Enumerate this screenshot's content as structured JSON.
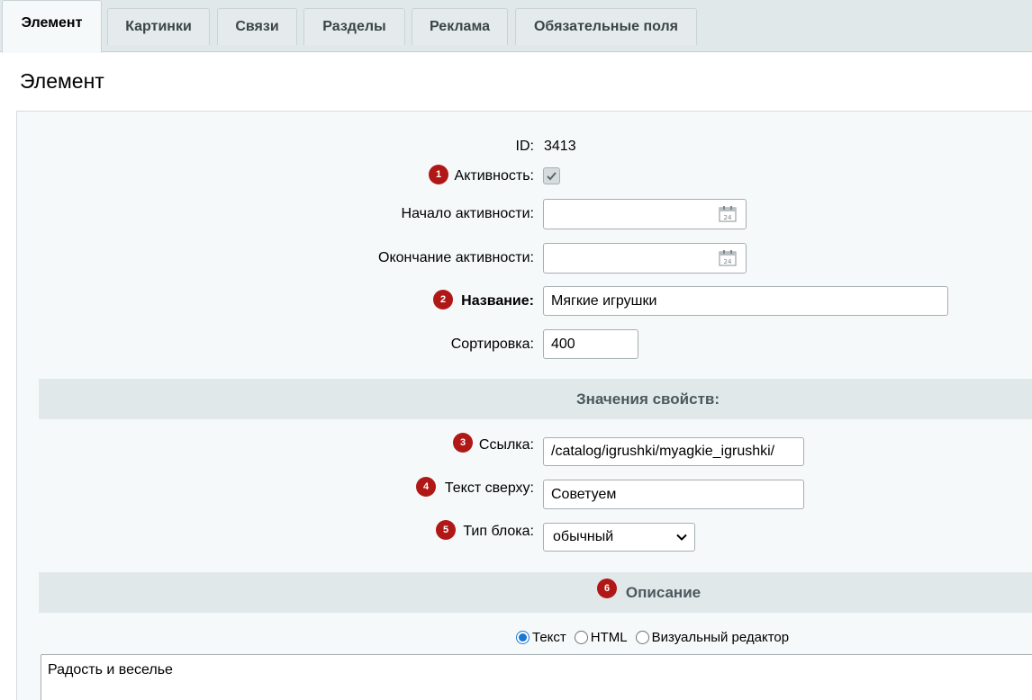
{
  "tabs": [
    {
      "label": "Элемент",
      "active": true
    },
    {
      "label": "Картинки",
      "active": false
    },
    {
      "label": "Связи",
      "active": false
    },
    {
      "label": "Разделы",
      "active": false
    },
    {
      "label": "Реклама",
      "active": false
    },
    {
      "label": "Обязательные поля",
      "active": false
    }
  ],
  "section_title": "Элемент",
  "form": {
    "id_label": "ID:",
    "id_value": "3413",
    "active_label": "Активность:",
    "active_checked": true,
    "active_from_label": "Начало активности:",
    "active_from_value": "",
    "active_to_label": "Окончание активности:",
    "active_to_value": "",
    "name_label": "Название:",
    "name_value": "Мягкие игрушки",
    "sort_label": "Сортировка:",
    "sort_value": "400"
  },
  "properties": {
    "header": "Значения свойств:",
    "link_label": "Ссылка:",
    "link_value": "/catalog/igrushki/myagkie_igrushki/",
    "top_text_label": "Текст сверху:",
    "top_text_value": "Советуем",
    "block_type_label": "Тип блока:",
    "block_type_value": "обычный"
  },
  "description": {
    "header": "Описание",
    "modes": [
      {
        "label": "Текст",
        "checked": true
      },
      {
        "label": "HTML",
        "checked": false
      },
      {
        "label": "Визуальный редактор",
        "checked": false
      }
    ],
    "text": "Радость и веселье"
  },
  "badges": [
    "1",
    "2",
    "3",
    "4",
    "5",
    "6"
  ],
  "colors": {
    "badge": "#b01818",
    "panel": "#f5f9f9",
    "tabbar": "#e0e8ea",
    "radio_accent": "#1976d2"
  }
}
